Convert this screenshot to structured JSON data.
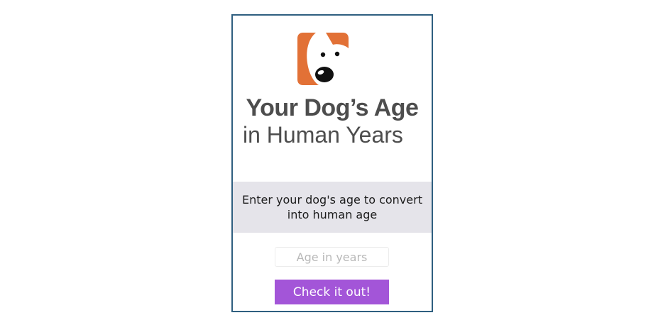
{
  "app": {
    "title_line1": "Your Dog’s Age",
    "title_line2": "in Human Years"
  },
  "logo": {
    "icon": "dog-face-icon",
    "colors": {
      "orange": "#e27136",
      "black": "#111111",
      "white": "#ffffff"
    }
  },
  "instruction": {
    "text": "Enter your dog's age to convert into human age"
  },
  "age_input": {
    "placeholder": "Age in years",
    "value": ""
  },
  "submit": {
    "label": "Check it out!",
    "color": "#a355d8"
  },
  "colors": {
    "frame_border": "#2f5f80",
    "band_background": "#e5e4ea",
    "title_text": "#4d4d4d"
  }
}
